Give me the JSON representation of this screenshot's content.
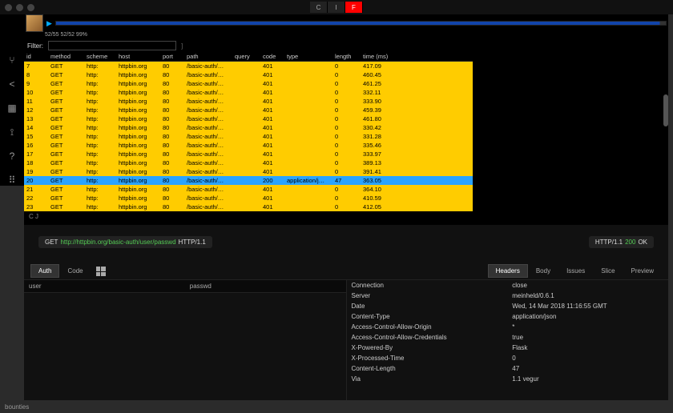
{
  "topButtons": [
    "C",
    "I",
    "F"
  ],
  "statusbar": "bounties",
  "progress": "52/55 52/52 99%",
  "filterLabel": "Filter:",
  "filterValue": "",
  "columns": [
    "id",
    "method",
    "scheme",
    "host",
    "port",
    "path",
    "query",
    "code",
    "type",
    "length",
    "time (ms)"
  ],
  "rows": [
    {
      "id": "7",
      "method": "GET",
      "scheme": "http:",
      "host": "httpbin.org",
      "port": "80",
      "path": "/basic-auth/…",
      "query": "",
      "code": "401",
      "type": "",
      "length": "0",
      "time": "417.09"
    },
    {
      "id": "8",
      "method": "GET",
      "scheme": "http:",
      "host": "httpbin.org",
      "port": "80",
      "path": "/basic-auth/…",
      "query": "",
      "code": "401",
      "type": "",
      "length": "0",
      "time": "460.45"
    },
    {
      "id": "9",
      "method": "GET",
      "scheme": "http:",
      "host": "httpbin.org",
      "port": "80",
      "path": "/basic-auth/…",
      "query": "",
      "code": "401",
      "type": "",
      "length": "0",
      "time": "461.25"
    },
    {
      "id": "10",
      "method": "GET",
      "scheme": "http:",
      "host": "httpbin.org",
      "port": "80",
      "path": "/basic-auth/…",
      "query": "",
      "code": "401",
      "type": "",
      "length": "0",
      "time": "332.11"
    },
    {
      "id": "11",
      "method": "GET",
      "scheme": "http:",
      "host": "httpbin.org",
      "port": "80",
      "path": "/basic-auth/…",
      "query": "",
      "code": "401",
      "type": "",
      "length": "0",
      "time": "333.90"
    },
    {
      "id": "12",
      "method": "GET",
      "scheme": "http:",
      "host": "httpbin.org",
      "port": "80",
      "path": "/basic-auth/…",
      "query": "",
      "code": "401",
      "type": "",
      "length": "0",
      "time": "459.39"
    },
    {
      "id": "13",
      "method": "GET",
      "scheme": "http:",
      "host": "httpbin.org",
      "port": "80",
      "path": "/basic-auth/…",
      "query": "",
      "code": "401",
      "type": "",
      "length": "0",
      "time": "461.80"
    },
    {
      "id": "14",
      "method": "GET",
      "scheme": "http:",
      "host": "httpbin.org",
      "port": "80",
      "path": "/basic-auth/…",
      "query": "",
      "code": "401",
      "type": "",
      "length": "0",
      "time": "330.42"
    },
    {
      "id": "15",
      "method": "GET",
      "scheme": "http:",
      "host": "httpbin.org",
      "port": "80",
      "path": "/basic-auth/…",
      "query": "",
      "code": "401",
      "type": "",
      "length": "0",
      "time": "331.28"
    },
    {
      "id": "16",
      "method": "GET",
      "scheme": "http:",
      "host": "httpbin.org",
      "port": "80",
      "path": "/basic-auth/…",
      "query": "",
      "code": "401",
      "type": "",
      "length": "0",
      "time": "335.46"
    },
    {
      "id": "17",
      "method": "GET",
      "scheme": "http:",
      "host": "httpbin.org",
      "port": "80",
      "path": "/basic-auth/…",
      "query": "",
      "code": "401",
      "type": "",
      "length": "0",
      "time": "333.97"
    },
    {
      "id": "18",
      "method": "GET",
      "scheme": "http:",
      "host": "httpbin.org",
      "port": "80",
      "path": "/basic-auth/…",
      "query": "",
      "code": "401",
      "type": "",
      "length": "0",
      "time": "389.13"
    },
    {
      "id": "19",
      "method": "GET",
      "scheme": "http:",
      "host": "httpbin.org",
      "port": "80",
      "path": "/basic-auth/…",
      "query": "",
      "code": "401",
      "type": "",
      "length": "0",
      "time": "391.41"
    },
    {
      "id": "20",
      "method": "GET",
      "scheme": "http:",
      "host": "httpbin.org",
      "port": "80",
      "path": "/basic-auth/…",
      "query": "",
      "code": "200",
      "type": "application/j…",
      "length": "47",
      "time": "363.05",
      "sel": true
    },
    {
      "id": "21",
      "method": "GET",
      "scheme": "http:",
      "host": "httpbin.org",
      "port": "80",
      "path": "/basic-auth/…",
      "query": "",
      "code": "401",
      "type": "",
      "length": "0",
      "time": "364.10"
    },
    {
      "id": "22",
      "method": "GET",
      "scheme": "http:",
      "host": "httpbin.org",
      "port": "80",
      "path": "/basic-auth/…",
      "query": "",
      "code": "401",
      "type": "",
      "length": "0",
      "time": "410.59"
    },
    {
      "id": "23",
      "method": "GET",
      "scheme": "http:",
      "host": "httpbin.org",
      "port": "80",
      "path": "/basic-auth/…",
      "query": "",
      "code": "401",
      "type": "",
      "length": "0",
      "time": "412.05"
    }
  ],
  "hint": "C  J",
  "request": {
    "method": "GET",
    "url": "http://httpbin.org/basic-auth/user/passwd",
    "proto": "HTTP/1.1"
  },
  "response": {
    "proto": "HTTP/1.1",
    "code": "200",
    "reason": "OK"
  },
  "tabsL": [
    "Auth",
    "Code"
  ],
  "tabsR": [
    "Headers",
    "Body",
    "Issues",
    "Slice",
    "Preview"
  ],
  "authCols": [
    "user",
    "passwd"
  ],
  "headers": [
    {
      "k": "Connection",
      "v": "close"
    },
    {
      "k": "Server",
      "v": "meinheld/0.6.1"
    },
    {
      "k": "Date",
      "v": "Wed, 14 Mar 2018 11:16:55 GMT"
    },
    {
      "k": "Content-Type",
      "v": "application/json"
    },
    {
      "k": "Access-Control-Allow-Origin",
      "v": "*"
    },
    {
      "k": "Access-Control-Allow-Credentials",
      "v": "true"
    },
    {
      "k": "X-Powered-By",
      "v": "Flask"
    },
    {
      "k": "X-Processed-Time",
      "v": "0"
    },
    {
      "k": "Content-Length",
      "v": "47"
    },
    {
      "k": "Via",
      "v": "1.1 vegur"
    }
  ]
}
